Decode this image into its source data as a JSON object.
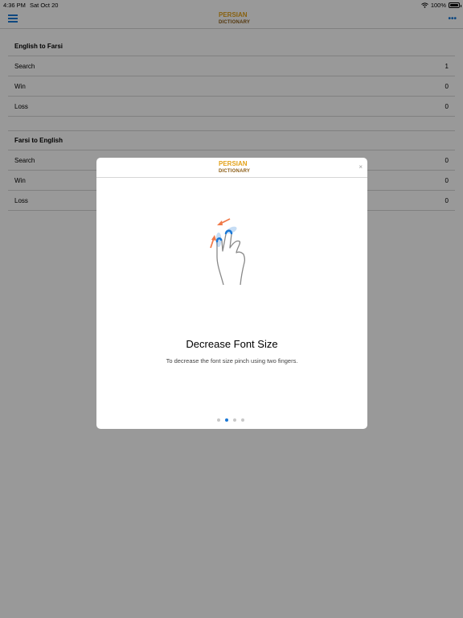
{
  "status_bar": {
    "time": "4:36 PM",
    "date": "Sat Oct 20",
    "battery": "100%"
  },
  "logo": {
    "line1": "PERSIAN",
    "line2": "DICTIONARY"
  },
  "accent_color": "#1a78d6",
  "sections": [
    {
      "title": "English to Farsi",
      "rows": [
        {
          "label": "Search",
          "value": "1"
        },
        {
          "label": "Win",
          "value": "0"
        },
        {
          "label": "Loss",
          "value": "0"
        }
      ]
    },
    {
      "title": "Farsi to English",
      "rows": [
        {
          "label": "Search",
          "value": "0"
        },
        {
          "label": "Win",
          "value": "0"
        },
        {
          "label": "Loss",
          "value": "0"
        }
      ]
    }
  ],
  "modal": {
    "close_label": "×",
    "title": "Decrease Font Size",
    "description": "To decrease the font size pinch using two fingers.",
    "page_count": 4,
    "active_page": 2,
    "illustration": "pinch-gesture-icon"
  }
}
